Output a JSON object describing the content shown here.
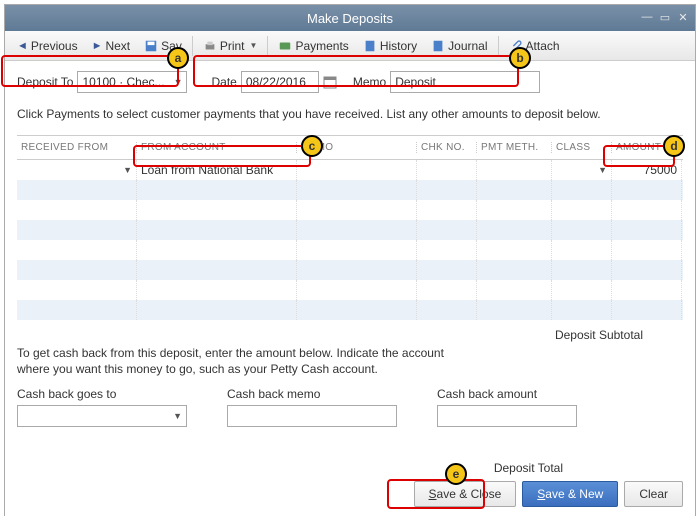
{
  "window": {
    "title": "Make Deposits"
  },
  "toolbar": {
    "previous": "Previous",
    "next": "Next",
    "save": "Sav",
    "print": "Print",
    "payments": "Payments",
    "history": "History",
    "journal": "Journal",
    "attach": "Attach"
  },
  "form": {
    "deposit_to_label": "Deposit To",
    "deposit_to_value": "10100 · Chec...",
    "date_label": "Date",
    "date_value": "08/22/2016",
    "memo_label": "Memo",
    "memo_value": "Deposit"
  },
  "help": {
    "line1": "Click Payments to select customer payments that you have received. List any other amounts to deposit below.",
    "cash1": "To get cash back from this deposit, enter the amount below.  Indicate the account",
    "cash2": "where you want this money to go, such as your Petty Cash account."
  },
  "grid": {
    "headers": {
      "received_from": "RECEIVED FROM",
      "from_account": "FROM ACCOUNT",
      "memo": "MEMO",
      "chk_no": "CHK NO.",
      "pmt_meth": "PMT METH.",
      "class": "CLASS",
      "amount": "AMOUNT"
    },
    "rows": [
      {
        "received_from": "",
        "from_account": "Loan from National Bank",
        "memo": "",
        "chk_no": "",
        "pmt_meth": "",
        "class": "",
        "amount": "75000"
      }
    ],
    "subtotal_label": "Deposit Subtotal"
  },
  "cashback": {
    "goes_to_label": "Cash back goes to",
    "memo_label": "Cash back memo",
    "amount_label": "Cash back amount"
  },
  "footer": {
    "total_label": "Deposit Total",
    "save_close": "Save & Close",
    "save_new": "Save & New",
    "clear": "Clear"
  },
  "callouts": {
    "a": "a",
    "b": "b",
    "c": "c",
    "d": "d",
    "e": "e"
  }
}
